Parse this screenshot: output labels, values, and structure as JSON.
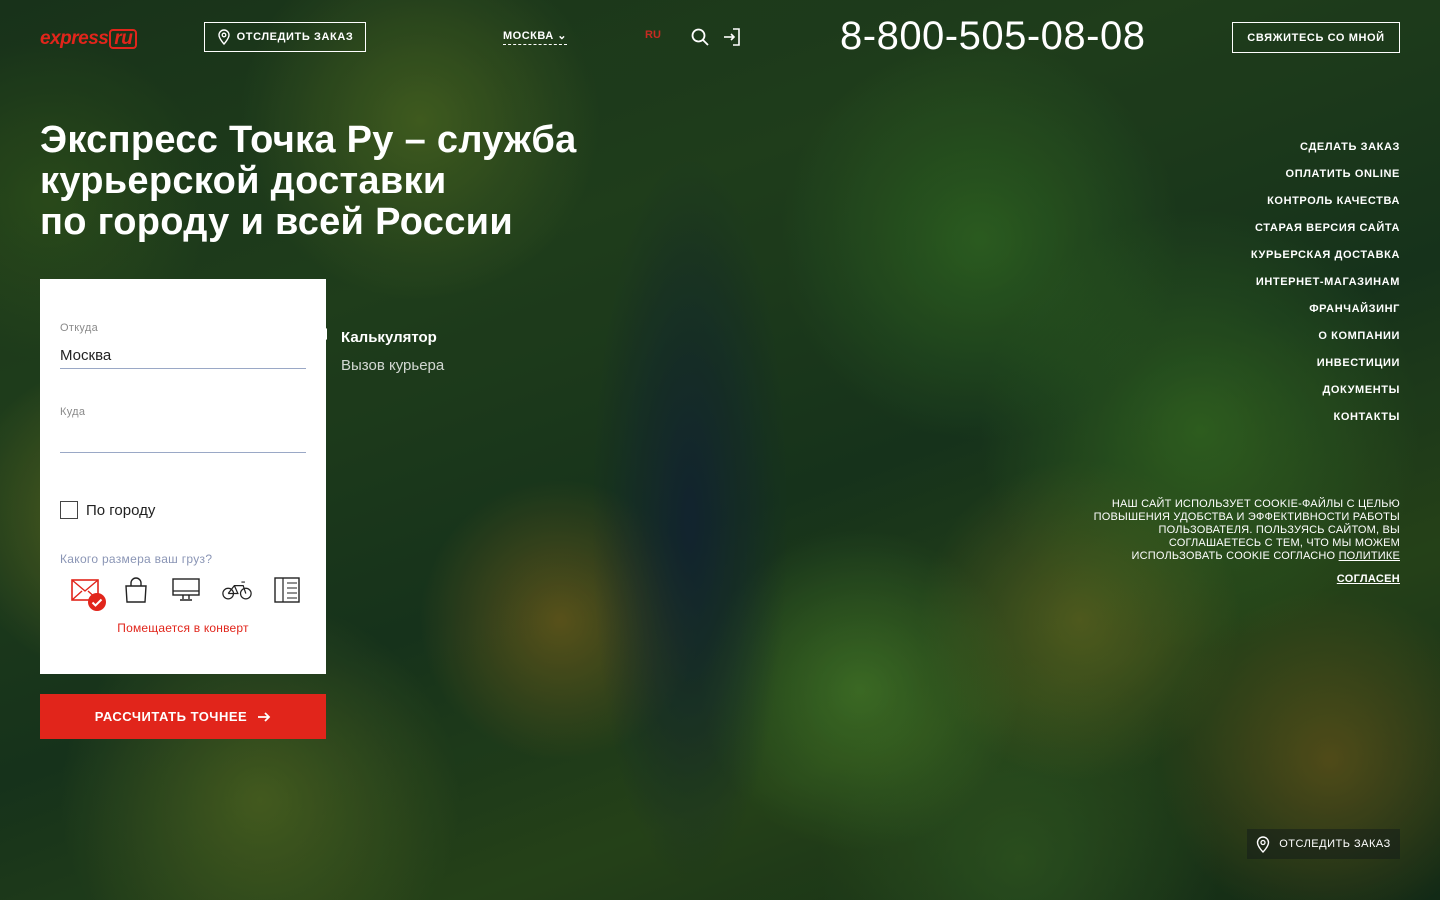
{
  "header": {
    "logo_main": "express",
    "logo_box": "ru",
    "track_order": "ОТСЛЕДИТЬ ЗАКАЗ",
    "city": "МОСКВА",
    "lang": "RU",
    "phone": "8-800-505-08-08",
    "contact_button": "СВЯЖИТЕСЬ СО МНОЙ"
  },
  "hero": {
    "line1": "Экспресс Точка Ру – служба",
    "line2": "курьерской доставки",
    "line3": "по городу и всей России"
  },
  "calculator": {
    "from_label": "Откуда",
    "from_value": "Москва",
    "to_label": "Куда",
    "to_value": "",
    "city_only_label": "По городу",
    "size_question": "Какого размера ваш груз?",
    "size_options": [
      "envelope",
      "bag",
      "monitor",
      "bicycle",
      "wardrobe"
    ],
    "selected_size": "envelope",
    "fit_text": "Помещается в конверт",
    "submit_label": "РАССЧИТАТЬ ТОЧНЕЕ"
  },
  "tabs": {
    "active": "Калькулятор",
    "inactive": "Вызов курьера"
  },
  "nav": {
    "items": [
      "СДЕЛАТЬ ЗАКАЗ",
      "ОПЛАТИТЬ ONLINE",
      "КОНТРОЛЬ КАЧЕСТВА",
      "СТАРАЯ ВЕРСИЯ САЙТА",
      "КУРЬЕРСКАЯ ДОСТАВКА",
      "ИНТЕРНЕТ-МАГАЗИНАМ",
      "ФРАНЧАЙЗИНГ",
      "О КОМПАНИИ",
      "ИНВЕСТИЦИИ",
      "ДОКУМЕНТЫ",
      "КОНТАКТЫ"
    ]
  },
  "cookie": {
    "text": "НАШ САЙТ ИСПОЛЬЗУЕТ COOKIE-ФАЙЛЫ С ЦЕЛЬЮ ПОВЫШЕНИЯ УДОБСТВА И ЭФФЕКТИВНОСТИ РАБОТЫ ПОЛЬЗОВАТЕЛЯ. ПОЛЬЗУЯСЬ САЙТОМ, ВЫ СОГЛАШАЕТЕСЬ С ТЕМ, ЧТО МЫ МОЖЕМ ИСПОЛЬЗОВАТЬ COOKIE СОГЛАСНО",
    "policy_link": "ПОЛИТИКЕ",
    "agree": "СОГЛАСЕН"
  },
  "footer": {
    "track_order": "ОТСЛЕДИТЬ ЗАКАЗ"
  },
  "colors": {
    "accent": "#e1251b",
    "input_underline": "#9aa8c6",
    "size_question": "#8a95b5"
  }
}
